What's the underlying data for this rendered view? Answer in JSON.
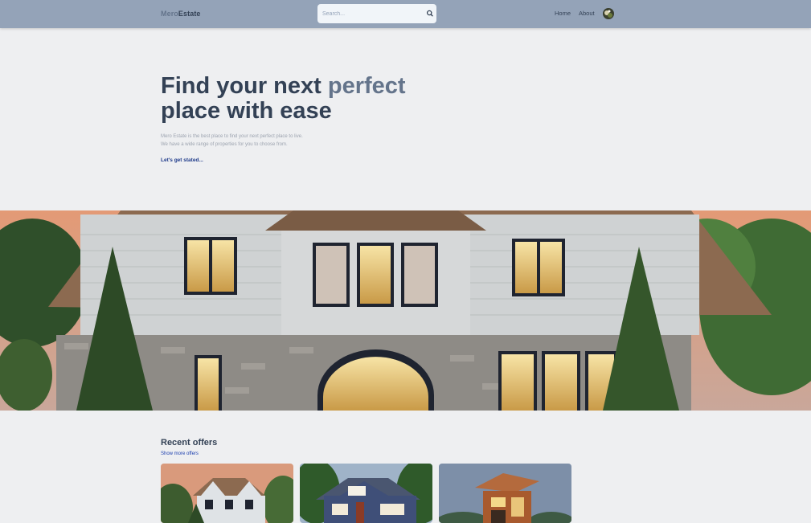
{
  "header": {
    "logo_part1": "Mero",
    "logo_part2": "Estate",
    "search_placeholder": "Search...",
    "nav": [
      {
        "label": "Home"
      },
      {
        "label": "About"
      }
    ]
  },
  "hero": {
    "title_line1": "Find your next",
    "title_accent": "perfect",
    "title_line2": "place with ease",
    "description_line1": "Mero Estate is the best place to find your next perfect place to live.",
    "description_line2": "We have a wide range of properties for you to choose from.",
    "cta": "Let's get stated..."
  },
  "offers": {
    "title": "Recent offers",
    "show_more": "Show more offers"
  },
  "icons": {
    "search": "search-icon",
    "avatar": "avatar"
  },
  "colors": {
    "header_bg": "#94a3b8",
    "page_bg": "#eeeff1",
    "title": "#334155",
    "accent": "#64748b",
    "link": "#1e40af"
  }
}
